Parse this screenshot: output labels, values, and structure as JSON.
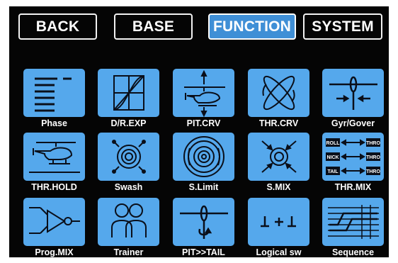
{
  "tabs": [
    {
      "label": "BACK"
    },
    {
      "label": "BASE"
    },
    {
      "label": "FUNCTION",
      "active": true
    },
    {
      "label": "SYSTEM"
    }
  ],
  "colors": {
    "background": "#050505",
    "tile": "#55a8ec",
    "active_tab": "#3f8fd6",
    "icon_ink": "#0a0f1a",
    "text": "#ffffff"
  },
  "functions": [
    {
      "label": "Phase",
      "icon": "list-lines-icon"
    },
    {
      "label": "D/R.EXP",
      "icon": "expo-curve-icon"
    },
    {
      "label": "PIT.CRV",
      "icon": "helicopter-pitch-icon"
    },
    {
      "label": "THR.CRV",
      "icon": "throttle-curve-icon"
    },
    {
      "label": "Gyr/Gover",
      "icon": "gyro-rotor-icon"
    },
    {
      "label": "THR.HOLD",
      "icon": "helicopter-landed-icon"
    },
    {
      "label": "Swash",
      "icon": "swashplate-icon"
    },
    {
      "label": "S.Limit",
      "icon": "swash-limit-icon"
    },
    {
      "label": "S.MIX",
      "icon": "swash-mix-icon"
    },
    {
      "label": "THR.MIX",
      "icon": "throttle-mix-icon"
    },
    {
      "label": "Prog.MIX",
      "icon": "program-mix-icon"
    },
    {
      "label": "Trainer",
      "icon": "trainer-users-icon"
    },
    {
      "label": "PIT>>TAIL",
      "icon": "pitch-to-tail-icon"
    },
    {
      "label": "Logical sw",
      "icon": "logical-switch-icon"
    },
    {
      "label": "Sequence",
      "icon": "sequence-graph-icon"
    }
  ],
  "thr_mix_rows": [
    "ROLL",
    "THRO",
    "NICK",
    "THRO",
    "TAIL",
    "THRO"
  ]
}
